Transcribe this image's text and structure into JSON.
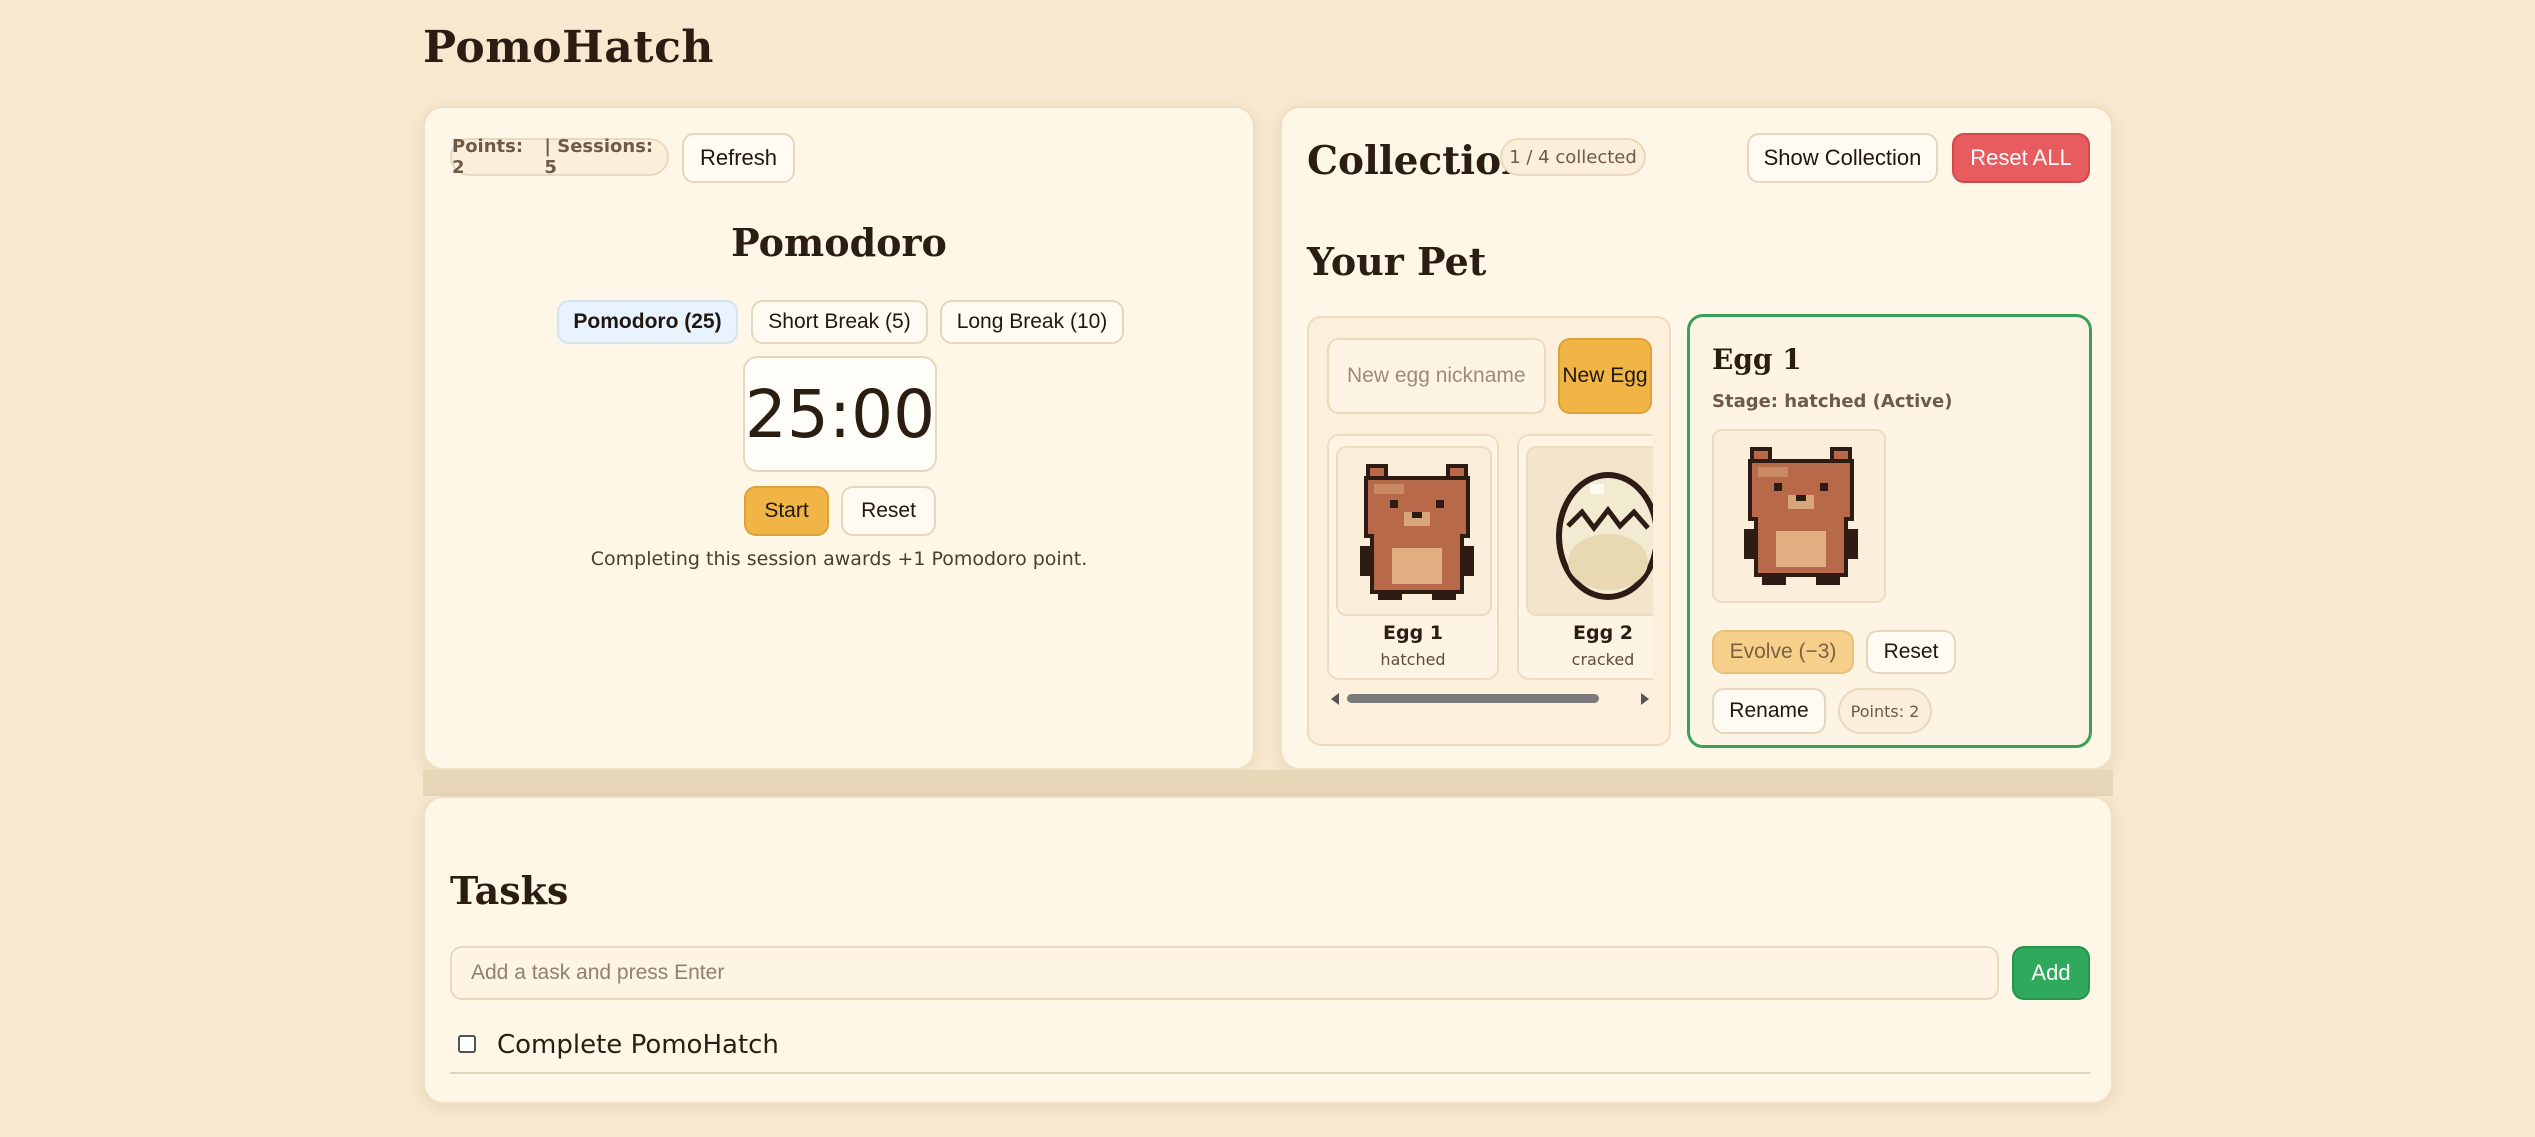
{
  "app": {
    "title": "PomoHatch"
  },
  "pomodoro": {
    "stats": {
      "points": "Points: 2",
      "sessions": "| Sessions: 5"
    },
    "refresh_label": "Refresh",
    "title": "Pomodoro",
    "modes": [
      {
        "label": "Pomodoro (25)",
        "selected": true
      },
      {
        "label": "Short Break (5)",
        "selected": false
      },
      {
        "label": "Long Break (10)",
        "selected": false
      }
    ],
    "timer": "25:00",
    "start_label": "Start",
    "reset_label": "Reset",
    "note": "Completing this session awards +1 Pomodoro point."
  },
  "collection": {
    "title": "Collection",
    "count": "1 / 4 collected",
    "show_label": "Show Collection",
    "reset_all_label": "Reset ALL",
    "pet_title": "Your Pet",
    "nickname_placeholder": "New egg nickname",
    "new_egg_label": "New Egg",
    "eggs": [
      {
        "name": "Egg 1",
        "stage": "hatched",
        "icon": "bear-sprite-icon"
      },
      {
        "name": "Egg 2",
        "stage": "cracked",
        "icon": "cracked-egg-icon"
      }
    ],
    "active_pet": {
      "name": "Egg 1",
      "stage": "Stage: hatched (Active)",
      "evolve_label": "Evolve (−3)",
      "reset_label": "Reset",
      "rename_label": "Rename",
      "points": "Points: 2"
    }
  },
  "tasks": {
    "title": "Tasks",
    "input_placeholder": "Add a task and press Enter",
    "add_label": "Add",
    "items": [
      {
        "text": "Complete PomoHatch",
        "done": false
      }
    ]
  },
  "colors": {
    "background": "#f7e8cf",
    "card": "#fef6e6",
    "accent_orange": "#f1b546",
    "danger": "#e85b5e",
    "success": "#2faa5c",
    "active_border": "#3aa05a"
  }
}
